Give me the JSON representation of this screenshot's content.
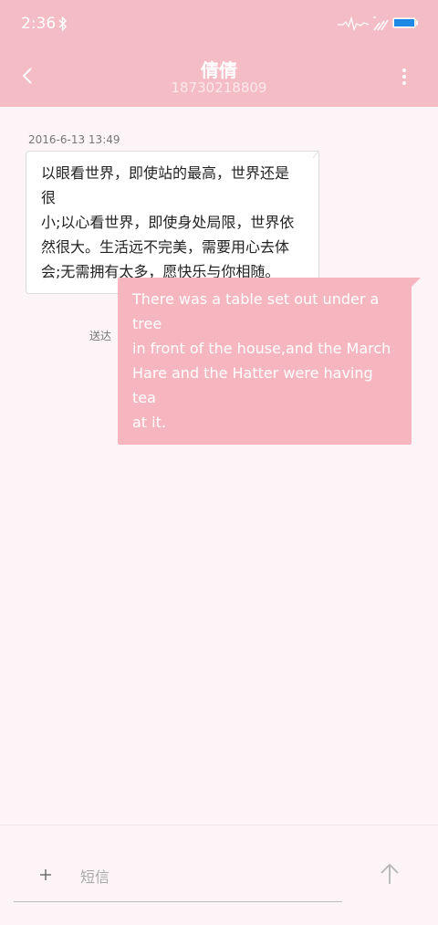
{
  "status_bar": {
    "time": "2:36",
    "icons": [
      "bluetooth-icon",
      "signal-icon",
      "wifi-icon",
      "battery-icon"
    ],
    "battery_color": "#1e88e5"
  },
  "header": {
    "contact_name": "倩倩",
    "phone_number": "18730218809",
    "background_color": "#f4bcc4"
  },
  "conversation": {
    "timestamp": "2016-6-13 13:49",
    "messages": [
      {
        "direction": "incoming",
        "lines": [
          "以眼看世界，即使站的最高，世界还是很",
          "小;以心看世界，即使身处局限，世界依",
          "然很大。生活远不完美，需要用心去体",
          "会;无需拥有太多，愿快乐与你相随。"
        ]
      },
      {
        "direction": "outgoing",
        "status": "送达",
        "lines": [
          "There was a table set out under a tree",
          "in front of the house,and the March",
          "Hare and the Hatter were having tea",
          "at it."
        ],
        "bubble_color": "#f5b6c0"
      }
    ]
  },
  "composer": {
    "placeholder": "短信",
    "value": ""
  }
}
